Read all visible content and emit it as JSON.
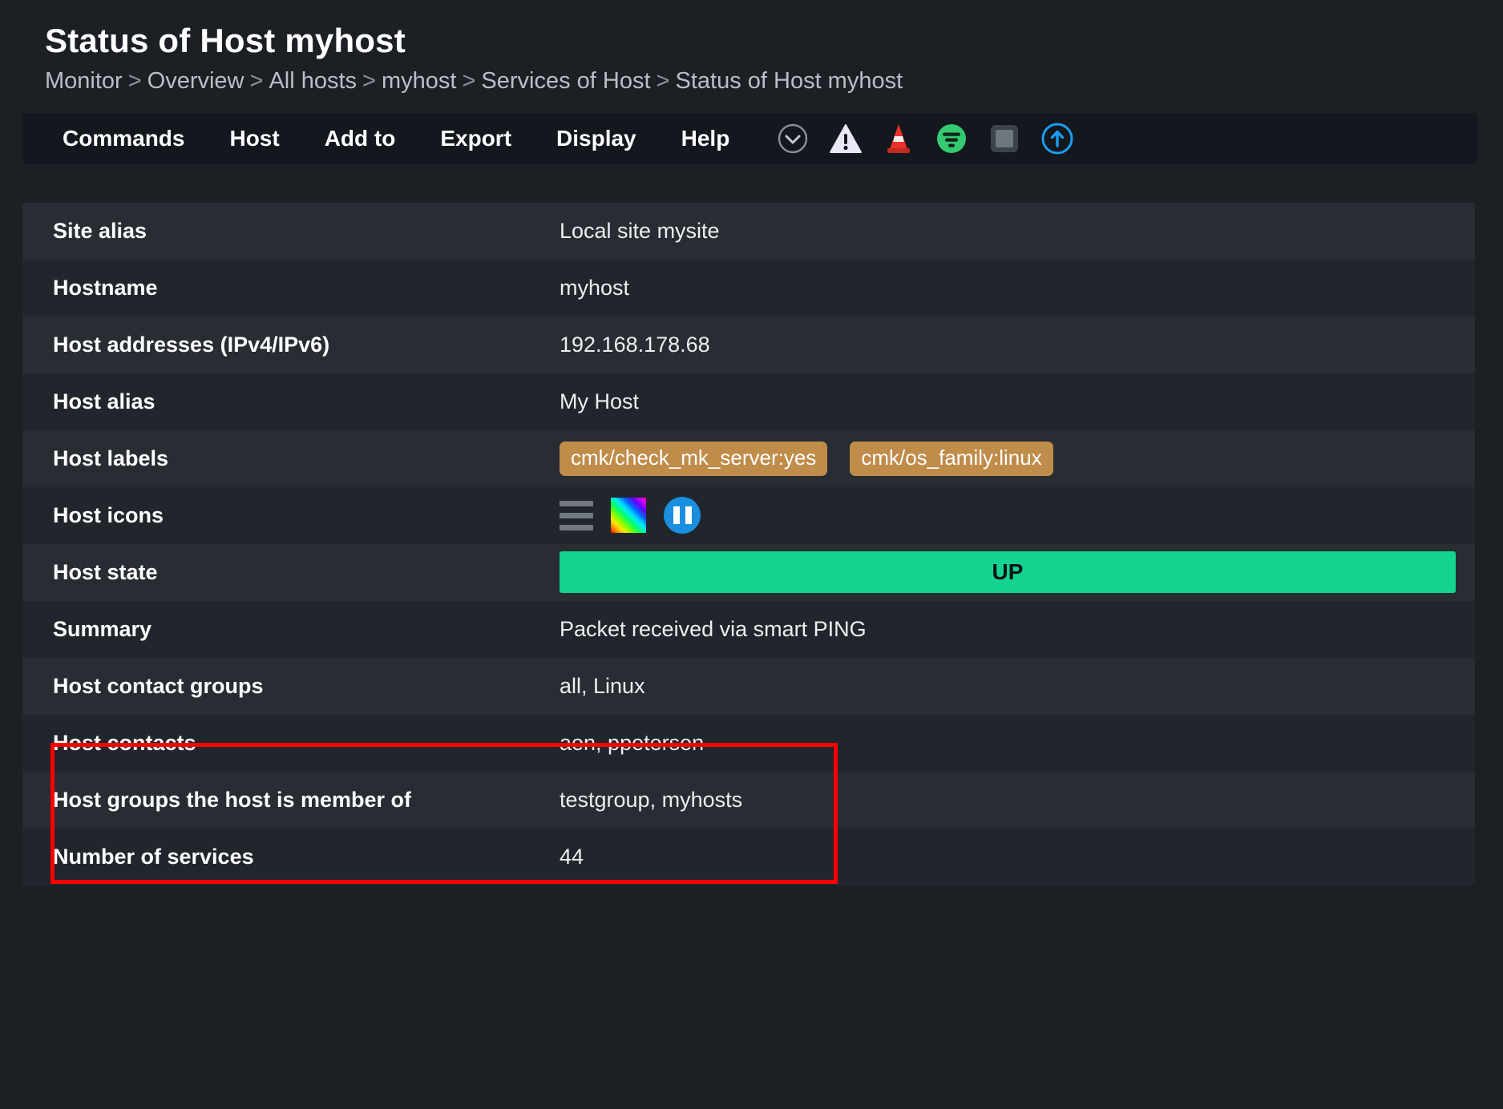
{
  "header": {
    "title": "Status of Host myhost",
    "breadcrumb": [
      "Monitor",
      "Overview",
      "All hosts",
      "myhost",
      "Services of Host",
      "Status of Host myhost"
    ],
    "separator": ">"
  },
  "toolbar": {
    "menus": [
      {
        "label": "Commands",
        "name": "menu-commands"
      },
      {
        "label": "Host",
        "name": "menu-host"
      },
      {
        "label": "Add to",
        "name": "menu-add-to"
      },
      {
        "label": "Export",
        "name": "menu-export"
      },
      {
        "label": "Display",
        "name": "menu-display"
      },
      {
        "label": "Help",
        "name": "menu-help"
      }
    ],
    "icons": [
      {
        "name": "chevron-down-circle-icon",
        "color": "#8a9099"
      },
      {
        "name": "warning-triangle-icon",
        "color": "#eceaf6"
      },
      {
        "name": "traffic-cone-icon",
        "color": "#e8322a"
      },
      {
        "name": "filter-circle-icon",
        "color": "#35c972"
      },
      {
        "name": "stop-square-icon",
        "color": "#6e757c"
      },
      {
        "name": "arrow-up-circle-icon",
        "color": "#1a9ef0"
      }
    ]
  },
  "table": {
    "rows": [
      {
        "label": "Site alias",
        "value": "Local site mysite",
        "type": "text"
      },
      {
        "label": "Hostname",
        "value": "myhost",
        "type": "text"
      },
      {
        "label": "Host addresses (IPv4/IPv6)",
        "value": "192.168.178.68",
        "type": "text"
      },
      {
        "label": "Host alias",
        "value": "My Host",
        "type": "text"
      },
      {
        "label": "Host labels",
        "type": "labels",
        "labels": [
          "cmk/check_mk_server:yes",
          "cmk/os_family:linux"
        ]
      },
      {
        "label": "Host icons",
        "type": "icons",
        "icons": [
          "hamburger-menu-icon",
          "rainbow-graph-icon",
          "pause-circle-icon"
        ]
      },
      {
        "label": "Host state",
        "value": "UP",
        "type": "state"
      },
      {
        "label": "Summary",
        "value": "Packet received via smart PING",
        "type": "text"
      },
      {
        "label": "Host contact groups",
        "value": "all, Linux",
        "type": "text"
      },
      {
        "label": "Host contacts",
        "value": "aen, ppetersen",
        "type": "text"
      },
      {
        "label": "Host groups the host is member of",
        "value": "testgroup, myhosts",
        "type": "text"
      },
      {
        "label": "Number of services",
        "value": "44",
        "type": "text"
      }
    ]
  },
  "colors": {
    "page_background": "#1c2025",
    "toolbar_background": "#13171e",
    "row_light": "#282d33",
    "row_dark": "#21262c",
    "label_chip": "#c08c4a",
    "state_up": "#13d38e",
    "highlight_border": "#ff0000"
  },
  "highlight": {
    "name": "contacts-highlight-box",
    "covers": [
      "Host contact groups",
      "Host contacts"
    ]
  }
}
